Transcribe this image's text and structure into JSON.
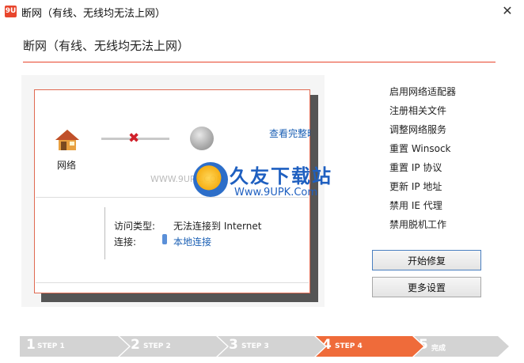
{
  "window": {
    "icon_text": "9U",
    "title": "断网（有线、无线均无法上网）",
    "close": "✕"
  },
  "heading": "断网（有线、无线均无法上网）",
  "diagram": {
    "network_label": "网络",
    "view_full": "查看完整映射",
    "access_type_label": "访问类型:",
    "access_type_value": "无法连接到 Internet",
    "connection_label": "连接:",
    "connection_value": "本地连接"
  },
  "watermark": {
    "text": "久友下载站",
    "url": "Www.9UPK.Com",
    "url_left": "WWW.9UPK.COM"
  },
  "repair_steps": [
    "启用网络适配器",
    "注册相关文件",
    "调整网络服务",
    "重置 Winsock",
    "重置 IP 协议",
    "更新 IP 地址",
    "禁用 IE 代理",
    "禁用脱机工作"
  ],
  "buttons": {
    "start": "开始修复",
    "more": "更多设置"
  },
  "progress": {
    "steps": [
      {
        "num": "1",
        "label": "STEP 1"
      },
      {
        "num": "2",
        "label": "STEP 2"
      },
      {
        "num": "3",
        "label": "STEP 3"
      },
      {
        "num": "4",
        "label": "STEP 4"
      },
      {
        "num": "5",
        "label": "完成"
      }
    ],
    "current_step": 4
  },
  "colors": {
    "accent": "#e8452c",
    "active_step": "#ef6b3a",
    "inactive_step": "#d3d3d3",
    "link": "#1a5fb4"
  }
}
